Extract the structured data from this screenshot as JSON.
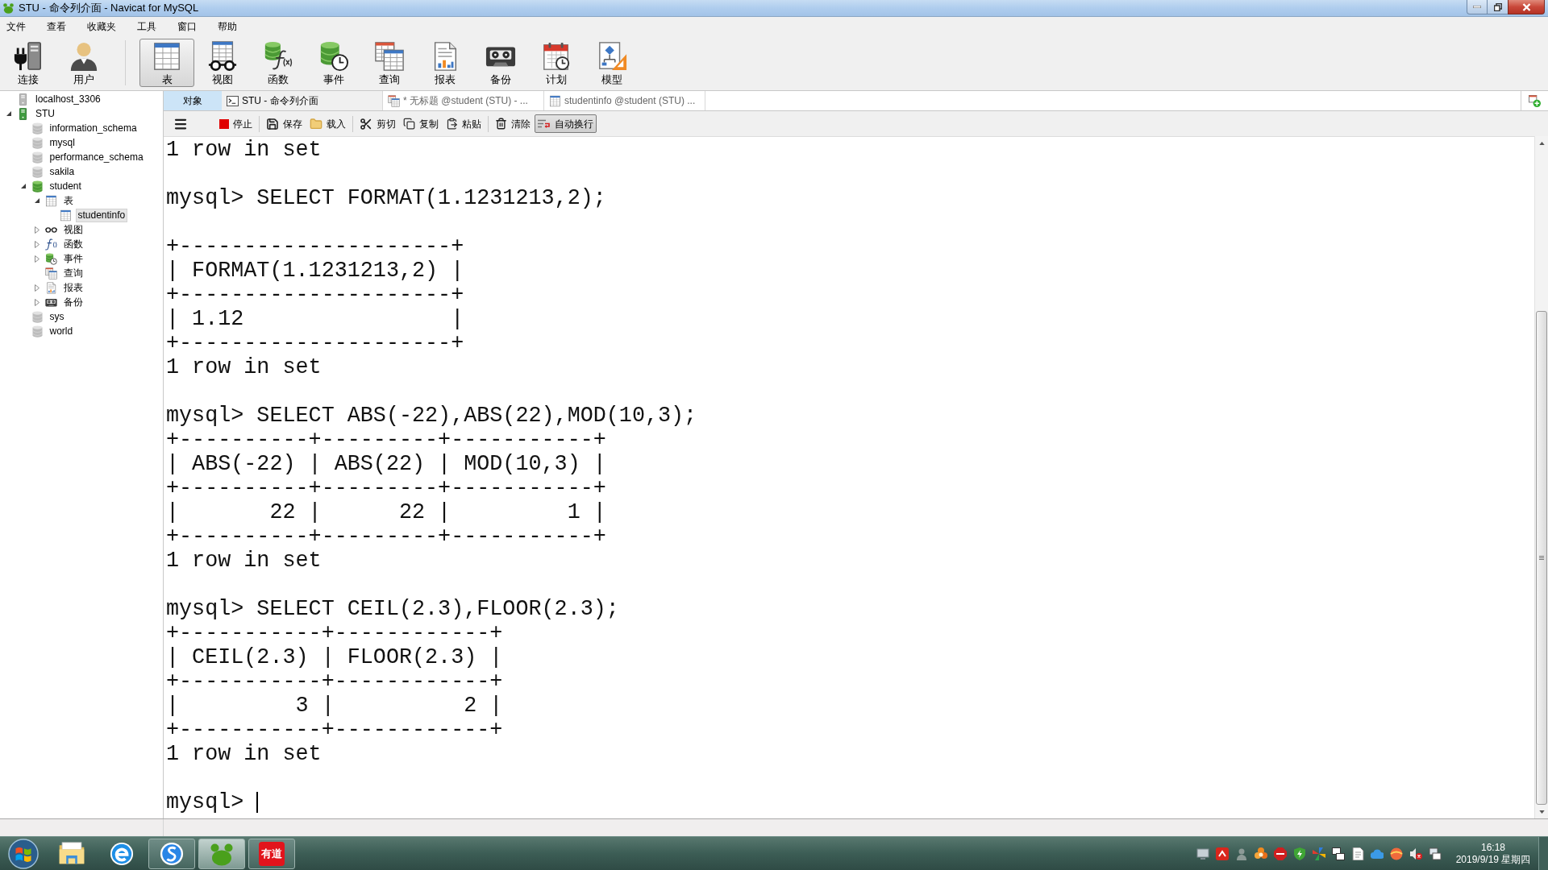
{
  "window": {
    "title": "STU - 命令列介面 - Navicat for MySQL"
  },
  "menu": [
    "文件",
    "查看",
    "收藏夹",
    "工具",
    "窗口",
    "帮助"
  ],
  "toolbar": {
    "groups": [
      [
        {
          "label": "连接",
          "kind": "connection",
          "selected": false
        },
        {
          "label": "用户",
          "kind": "user",
          "selected": false
        }
      ],
      [
        {
          "label": "表",
          "kind": "table",
          "selected": true
        },
        {
          "label": "视图",
          "kind": "view",
          "selected": false
        },
        {
          "label": "函数",
          "kind": "function",
          "selected": false
        },
        {
          "label": "事件",
          "kind": "event",
          "selected": false
        },
        {
          "label": "查询",
          "kind": "query",
          "selected": false
        },
        {
          "label": "报表",
          "kind": "report",
          "selected": false
        },
        {
          "label": "备份",
          "kind": "backup",
          "selected": false
        },
        {
          "label": "计划",
          "kind": "schedule",
          "selected": false
        },
        {
          "label": "模型",
          "kind": "model",
          "selected": false
        }
      ]
    ]
  },
  "navigator": {
    "tree": [
      {
        "label": "localhost_3306",
        "kind": "connection",
        "open": false,
        "selected": false
      },
      {
        "label": "STU",
        "kind": "connection",
        "open": true,
        "expanded": true,
        "selected": false,
        "children": [
          {
            "label": "information_schema",
            "kind": "database",
            "open": false,
            "selected": false
          },
          {
            "label": "mysql",
            "kind": "database",
            "open": false,
            "selected": false
          },
          {
            "label": "performance_schema",
            "kind": "database",
            "open": false,
            "selected": false
          },
          {
            "label": "sakila",
            "kind": "database",
            "open": false,
            "selected": false
          },
          {
            "label": "student",
            "kind": "database",
            "open": true,
            "expanded": true,
            "selected": false,
            "children": [
              {
                "label": "表",
                "kind": "table",
                "expanded": true,
                "selected": false,
                "children": [
                  {
                    "label": "studentinfo",
                    "kind": "table",
                    "selected": true
                  }
                ]
              },
              {
                "label": "视图",
                "kind": "view",
                "expanded": false,
                "selected": false
              },
              {
                "label": "函数",
                "kind": "function",
                "expanded": false,
                "selected": false
              },
              {
                "label": "事件",
                "kind": "event",
                "expanded": false,
                "selected": false
              },
              {
                "label": "查询",
                "kind": "query",
                "selected": false
              },
              {
                "label": "报表",
                "kind": "report",
                "expanded": false,
                "selected": false
              },
              {
                "label": "备份",
                "kind": "backup",
                "expanded": false,
                "selected": false
              }
            ]
          },
          {
            "label": "sys",
            "kind": "database",
            "open": false,
            "selected": false
          },
          {
            "label": "world",
            "kind": "database",
            "open": false,
            "selected": false
          }
        ]
      }
    ]
  },
  "tabs": [
    {
      "label": "对象",
      "kind": "objects",
      "selected": false
    },
    {
      "label": "STU - 命令列介面",
      "kind": "console",
      "selected": true
    },
    {
      "label": "* 无标题 @student (STU) - ...",
      "kind": "query",
      "selected": false
    },
    {
      "label": "studentinfo @student (STU) ...",
      "kind": "table",
      "selected": false
    }
  ],
  "console_toolbar": {
    "groups": [
      [
        {
          "kind": "menu",
          "pressed": false
        },
        {
          "kind": "stop",
          "label": "停止",
          "pressed": false
        }
      ],
      [
        {
          "kind": "save",
          "label": "保存",
          "pressed": false
        },
        {
          "kind": "load",
          "label": "载入",
          "pressed": false
        }
      ],
      [
        {
          "kind": "cut",
          "label": "剪切",
          "pressed": false
        },
        {
          "kind": "copy",
          "label": "复制",
          "pressed": false
        },
        {
          "kind": "paste",
          "label": "粘贴",
          "pressed": false
        }
      ],
      [
        {
          "kind": "clear",
          "label": "清除",
          "pressed": false
        },
        {
          "kind": "wrap",
          "label": "自动换行",
          "pressed": true
        }
      ]
    ]
  },
  "console": {
    "blocks": [
      [
        "1 row in set"
      ],
      [
        "mysql> SELECT FORMAT(1.1231213,2);"
      ],
      [
        "+---------------------+",
        "| FORMAT(1.1231213,2) |",
        "+---------------------+",
        "| 1.12                |",
        "+---------------------+",
        "1 row in set"
      ],
      [
        "mysql> SELECT ABS(-22),ABS(22),MOD(10,3);",
        "+----------+---------+-----------+",
        "| ABS(-22) | ABS(22) | MOD(10,3) |",
        "+----------+---------+-----------+",
        "|       22 |      22 |         1 |",
        "+----------+---------+-----------+",
        "1 row in set"
      ],
      [
        "mysql> SELECT CEIL(2.3),FLOOR(2.3);",
        "+-----------+------------+",
        "| CEIL(2.3) | FLOOR(2.3) |",
        "+-----------+------------+",
        "|         3 |          2 |",
        "+-----------+------------+",
        "1 row in set"
      ]
    ],
    "prompt": "mysql>"
  },
  "taskbar": {
    "apps": [
      {
        "kind": "folder",
        "running": false,
        "active": false
      },
      {
        "kind": "browser",
        "running": false,
        "active": false
      },
      {
        "kind": "ime",
        "running": true,
        "active": false
      },
      {
        "kind": "database_client",
        "running": true,
        "active": true
      },
      {
        "kind": "dictionary",
        "running": true,
        "active": false,
        "label": "有道"
      }
    ],
    "clock": {
      "time": "16:18",
      "date": "2019/9/19 星期四"
    }
  }
}
